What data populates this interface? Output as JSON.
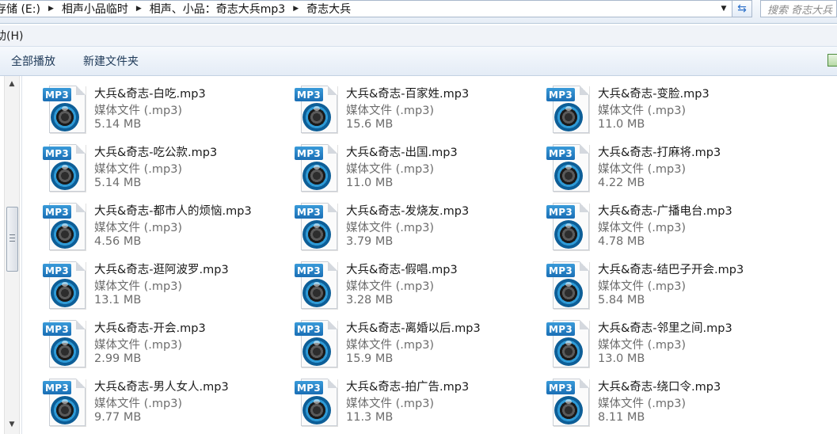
{
  "address_bar": {
    "crumbs": [
      "存储 (E:)",
      "相声小品临时",
      "相声、小品：奇志大兵mp3",
      "奇志大兵"
    ],
    "search_placeholder": "搜索 奇志大兵"
  },
  "menu": {
    "help": "助(H)"
  },
  "toolbar": {
    "play_all": "全部播放",
    "new_folder": "新建文件夹"
  },
  "files": [
    {
      "name": "大兵&奇志-白吃.mp3",
      "type": "媒体文件 (.mp3)",
      "size": "5.14 MB"
    },
    {
      "name": "大兵&奇志-百家姓.mp3",
      "type": "媒体文件 (.mp3)",
      "size": "15.6 MB"
    },
    {
      "name": "大兵&奇志-变脸.mp3",
      "type": "媒体文件 (.mp3)",
      "size": "11.0 MB"
    },
    {
      "name": "大兵&奇志-吃公款.mp3",
      "type": "媒体文件 (.mp3)",
      "size": "5.14 MB"
    },
    {
      "name": "大兵&奇志-出国.mp3",
      "type": "媒体文件 (.mp3)",
      "size": "11.0 MB"
    },
    {
      "name": "大兵&奇志-打麻将.mp3",
      "type": "媒体文件 (.mp3)",
      "size": "4.22 MB"
    },
    {
      "name": "大兵&奇志-都市人的烦恼.mp3",
      "type": "媒体文件 (.mp3)",
      "size": "4.56 MB"
    },
    {
      "name": "大兵&奇志-发烧友.mp3",
      "type": "媒体文件 (.mp3)",
      "size": "3.79 MB"
    },
    {
      "name": "大兵&奇志-广播电台.mp3",
      "type": "媒体文件 (.mp3)",
      "size": "4.78 MB"
    },
    {
      "name": "大兵&奇志-逛阿波罗.mp3",
      "type": "媒体文件 (.mp3)",
      "size": "13.1 MB"
    },
    {
      "name": "大兵&奇志-假唱.mp3",
      "type": "媒体文件 (.mp3)",
      "size": "3.28 MB"
    },
    {
      "name": "大兵&奇志-结巴子开会.mp3",
      "type": "媒体文件 (.mp3)",
      "size": "5.84 MB"
    },
    {
      "name": "大兵&奇志-开会.mp3",
      "type": "媒体文件 (.mp3)",
      "size": "2.99 MB"
    },
    {
      "name": "大兵&奇志-离婚以后.mp3",
      "type": "媒体文件 (.mp3)",
      "size": "15.9 MB"
    },
    {
      "name": "大兵&奇志-邻里之间.mp3",
      "type": "媒体文件 (.mp3)",
      "size": "13.0 MB"
    },
    {
      "name": "大兵&奇志-男人女人.mp3",
      "type": "媒体文件 (.mp3)",
      "size": "9.77 MB"
    },
    {
      "name": "大兵&奇志-拍广告.mp3",
      "type": "媒体文件 (.mp3)",
      "size": "11.3 MB"
    },
    {
      "name": "大兵&奇志-绕口令.mp3",
      "type": "媒体文件 (.mp3)",
      "size": "8.11 MB"
    }
  ],
  "icon_badge": "MP3"
}
